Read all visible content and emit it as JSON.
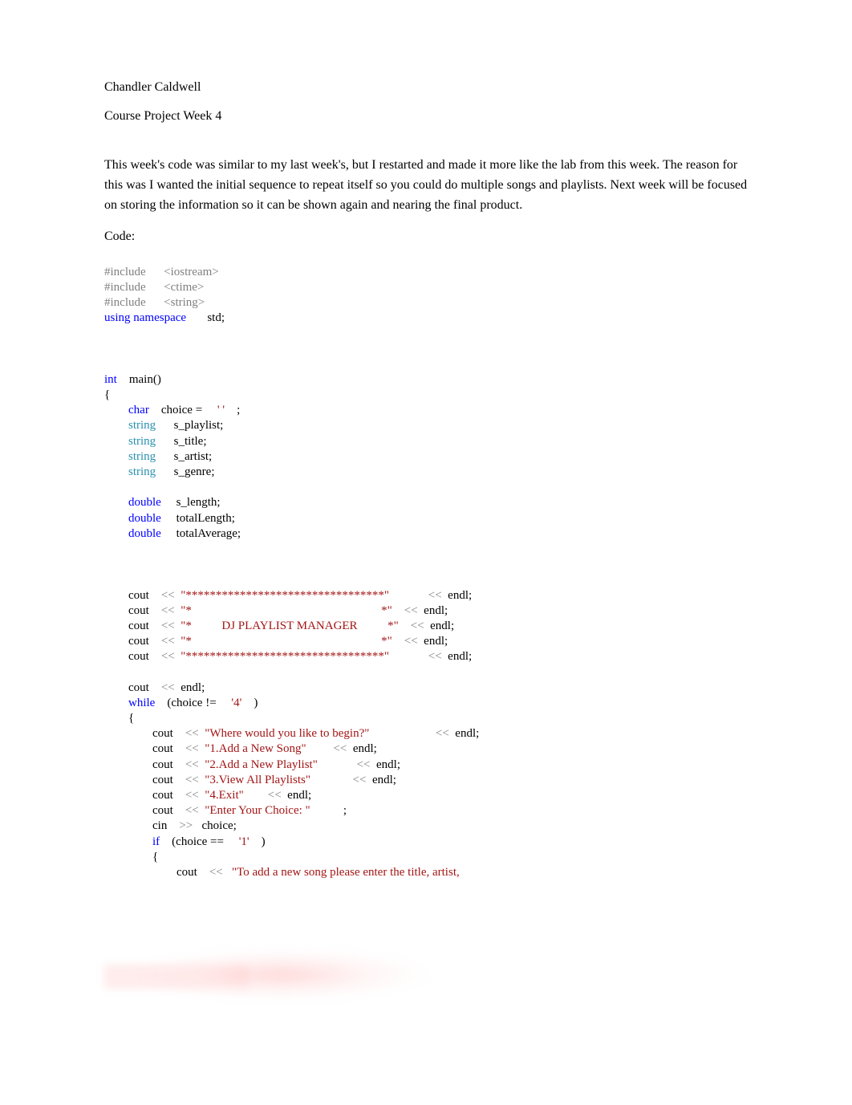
{
  "header": {
    "name": "Chandler Caldwell",
    "title": "Course Project Week 4"
  },
  "paragraph": "This week's code was similar to my last week's, but I restarted and made it more like the lab from this week. The reason for this was I wanted the initial sequence to repeat itself so you could do multiple songs and playlists. Next week will be focused on storing the information so it can be shown again and nearing the final product.",
  "code_label": "Code:",
  "code": {
    "includes": [
      {
        "kw": "#include",
        "lib": "<iostream>"
      },
      {
        "kw": "#include",
        "lib": "<ctime>"
      },
      {
        "kw": "#include",
        "lib": "<string>"
      }
    ],
    "using_kw": "using namespace",
    "using_val": "std;",
    "int_kw": "int",
    "main_name": "main()",
    "brace_open": "{",
    "char_kw": "char",
    "char_decl": "choice = ",
    "char_lit": "' '",
    "char_semi": ";",
    "string_kw": "string",
    "vars_string": [
      "s_playlist;",
      "s_title;",
      "s_artist;",
      "s_genre;"
    ],
    "double_kw": "double",
    "vars_double": [
      "s_length;",
      "totalLength;",
      "totalAverage;"
    ],
    "cout_kw": "cout",
    "op": "<<",
    "endl": "endl;",
    "stars": "\"*********************************\"",
    "star_open": "\"*",
    "star_close": "*\"",
    "dj_title": "          DJ PLAYLIST MANAGER          ",
    "while_kw": "while",
    "while_cond_open": "(choice != ",
    "while_cond_lit": "'4'",
    "while_cond_close": ")",
    "prompt_begin": "\"Where would you like to begin?\"",
    "opt1": "\"1.Add a New Song\"",
    "opt2": "\"2.Add a New Playlist\"",
    "opt3": "\"3.View All Playlists\"",
    "opt4": "\"4.Exit\"",
    "enter_choice": "\"Enter Your Choice: \"",
    "cin_kw": "cin",
    "cin_op": ">>",
    "cin_var": "choice;",
    "if_kw": "if",
    "if_cond_open": "(choice == ",
    "if_cond_lit": "'1'",
    "if_cond_close": ")",
    "add_song_prompt": "\"To add a new song please enter the title, artist,",
    "semi": ";"
  }
}
